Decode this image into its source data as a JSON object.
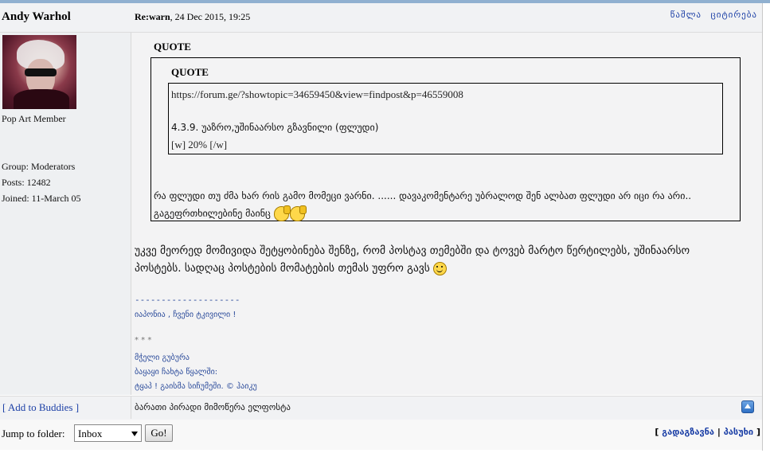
{
  "post": {
    "author": "Andy Warhol",
    "subject": "Re:warn",
    "date": ", 24 Dec 2015, 19:25",
    "actions": [
      "წაშლა",
      "ციტირება"
    ]
  },
  "profile": {
    "title": "Pop Art Member",
    "group": "Group: Moderators",
    "posts": "Posts: 12482",
    "joined": "Joined: 11-March 05"
  },
  "content": {
    "quote_label_outer": "QUOTE",
    "quote_label_inner": "QUOTE",
    "inner_link": "https://forum.ge/?showtopic=34659450&view=findpost&p=46559008",
    "inner_line2": "4.3.9. უაზრო,უშინაარსო გზავნილი (ფლუდი)",
    "inner_line3": "[w] 20% [/w]",
    "outer_line1": "რა ფლუდი თუ ძმა ხარ რის გამო მომეცი ვარნი. ...... დავაკომენტარე უბრალოდ შენ ალბათ ფლუდი არ იცი რა არი..",
    "outer_line2": "გაგეფრთხილებინე მაინც",
    "main_line1": "უკვე მეორედ მომივიდა შეტყობინება შენზე, რომ პოსტავ თემებში და ტოვებ მარტო წერტილებს, უშინაარსო",
    "main_line2": "პოსტებს. სადღაც პოსტების მომატების თემას უფრო გავს"
  },
  "signature": {
    "dashes": "--------------------",
    "line1": "იაპონია , ჩვენი ტკივილი !",
    "stars": "* * *",
    "line2": "მჭელი გუბურა",
    "line3": "ბაყაყი ჩახტა წყალში:",
    "line4": "ტყაპ ! გაისმა სიჩუმეში. © ჰაიკუ"
  },
  "footer": {
    "add_buddies": "[ Add to Buddies ]",
    "pm_link": "ბარათი პირადი მიმოწერა ელფოსტა",
    "up_icon": "up-arrow-icon"
  },
  "bottom": {
    "jump_label": "Jump to folder:",
    "folder_value": "Inbox",
    "go_label": "Go!",
    "bracket_open": "[",
    "forward_label": "გადაგზავნა",
    "separator": "|",
    "reply_label": "პასუხი",
    "bracket_close": "]"
  }
}
